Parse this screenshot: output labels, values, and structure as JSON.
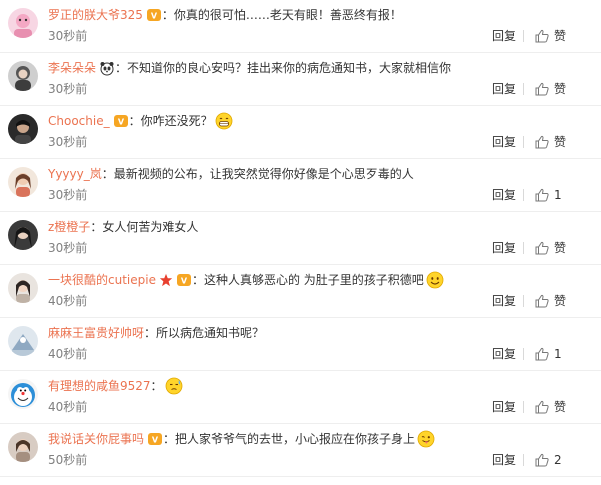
{
  "colors": {
    "username": "#eb7350",
    "text": "#333333",
    "time": "#808080",
    "divider": "#eeeeee"
  },
  "comments": [
    {
      "username": "罗正的朕大爷325",
      "badges": [
        "vip-badge-icon"
      ],
      "content": "你真的很可怕……老天有眼！善恶终有报！",
      "time": "30秒前",
      "reply": "回复",
      "like": "赞",
      "emoji": null,
      "avatar": "avatar-1"
    },
    {
      "username": "李朵朵朵",
      "badges": [
        "panda-badge-icon"
      ],
      "content": "不知道你的良心安吗？挂出来你的病危通知书，大家就相信你",
      "time": "30秒前",
      "reply": "回复",
      "like": "赞",
      "emoji": null,
      "avatar": "avatar-2"
    },
    {
      "username": "Choochie_",
      "badges": [
        "vip-badge-icon"
      ],
      "content": "你咋还没死？",
      "time": "30秒前",
      "reply": "回复",
      "like": "赞",
      "emoji": "grin-emoji-icon",
      "avatar": "avatar-3"
    },
    {
      "username": "Yyyyy_岚",
      "badges": [],
      "content": "最新视频的公布，让我突然觉得你好像是个心思歹毒的人",
      "time": "30秒前",
      "reply": "回复",
      "like": "1",
      "emoji": null,
      "avatar": "avatar-4"
    },
    {
      "username": "z橙橙子",
      "badges": [],
      "content": "女人何苦为难女人",
      "time": "30秒前",
      "reply": "回复",
      "like": "赞",
      "emoji": null,
      "avatar": "avatar-5"
    },
    {
      "username": "一块很酷的cutiepie",
      "badges": [
        "star-badge-icon",
        "vip-badge-icon"
      ],
      "content": "这种人真够恶心的 为肚子里的孩子积德吧",
      "time": "40秒前",
      "reply": "回复",
      "like": "赞",
      "emoji": "smile-emoji-icon",
      "avatar": "avatar-6"
    },
    {
      "username": "麻麻王富贵好帅呀",
      "badges": [],
      "content": "所以病危通知书呢？",
      "time": "40秒前",
      "reply": "回复",
      "like": "1",
      "emoji": null,
      "avatar": "avatar-7"
    },
    {
      "username": "有理想的咸鱼9527",
      "badges": [],
      "content": "",
      "time": "40秒前",
      "reply": "回复",
      "like": "赞",
      "emoji": "sweat-emoji-icon",
      "avatar": "avatar-8"
    },
    {
      "username": "我说话关你屁事吗",
      "badges": [
        "vip-badge-icon"
      ],
      "content": "把人家爷爷气的去世，小心报应在你孩子身上",
      "time": "50秒前",
      "reply": "回复",
      "like": "2",
      "emoji": "tongue-emoji-icon",
      "avatar": "avatar-9"
    }
  ]
}
